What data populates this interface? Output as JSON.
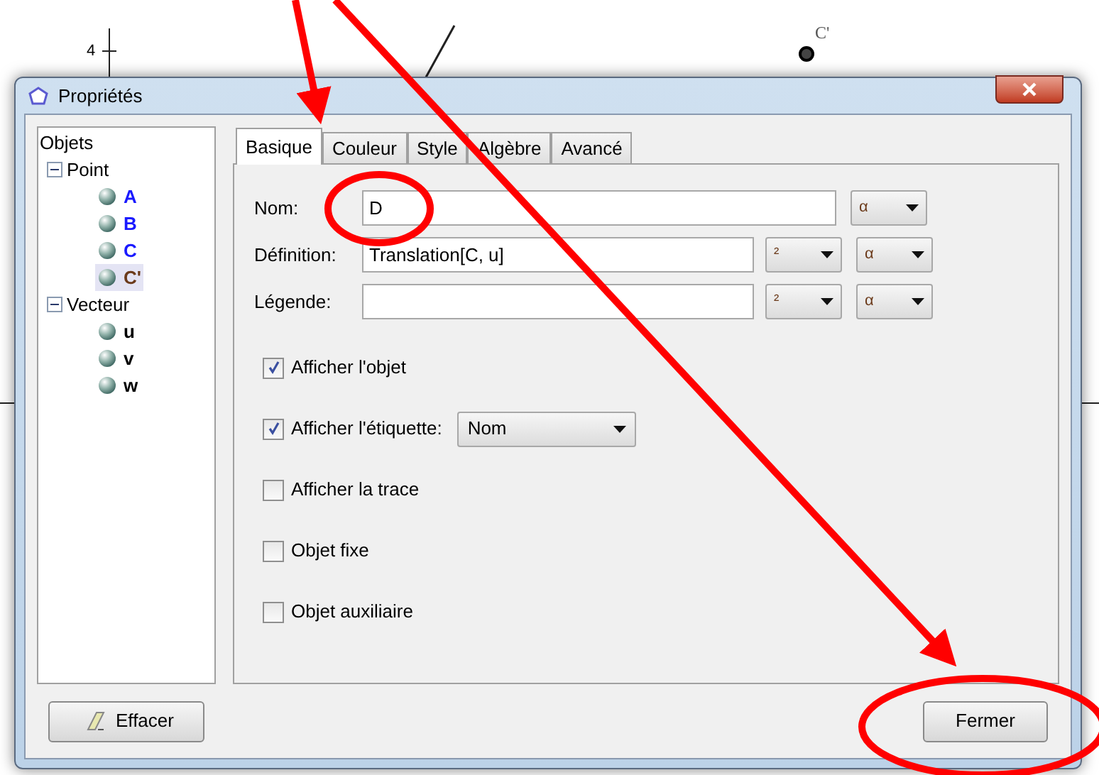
{
  "canvas": {
    "y_tick_label": "4",
    "point_label": "C'"
  },
  "window": {
    "title": "Propriétés"
  },
  "tree": {
    "label": "Objets",
    "children": [
      {
        "label": "Point",
        "expanded": true,
        "children": [
          {
            "label": "A",
            "color": "#1a1aff",
            "selected": false
          },
          {
            "label": "B",
            "color": "#1a1aff",
            "selected": false
          },
          {
            "label": "C",
            "color": "#1a1aff",
            "selected": false
          },
          {
            "label": "C'",
            "color": "#6b3a1a",
            "selected": true
          }
        ]
      },
      {
        "label": "Vecteur",
        "expanded": true,
        "children": [
          {
            "label": "u",
            "color": "#000000",
            "selected": false
          },
          {
            "label": "v",
            "color": "#000000",
            "selected": false
          },
          {
            "label": "w",
            "color": "#000000",
            "selected": false
          }
        ]
      }
    ]
  },
  "tabs": [
    {
      "label": "Basique",
      "selected": true
    },
    {
      "label": "Couleur",
      "selected": false
    },
    {
      "label": "Style",
      "selected": false
    },
    {
      "label": "Algèbre",
      "selected": false
    },
    {
      "label": "Avancé",
      "selected": false
    }
  ],
  "fields": [
    {
      "label": "Nom:",
      "value": "D",
      "selectors": [
        "α"
      ]
    },
    {
      "label": "Définition:",
      "value": "Translation[C, u]",
      "selectors": [
        "²",
        "α"
      ]
    },
    {
      "label": "Légende:",
      "selectors": [
        "²",
        "α"
      ]
    }
  ],
  "checkboxes": [
    {
      "label": "Afficher l'objet",
      "checked": true
    },
    {
      "label": "Afficher l'étiquette:",
      "checked": true,
      "dropdown": "Nom"
    },
    {
      "label": "Afficher la trace",
      "checked": false
    },
    {
      "label": "Objet fixe",
      "checked": false
    },
    {
      "label": "Objet auxiliaire",
      "checked": false
    }
  ],
  "buttons": {
    "left": "Effacer",
    "right": "Fermer"
  }
}
